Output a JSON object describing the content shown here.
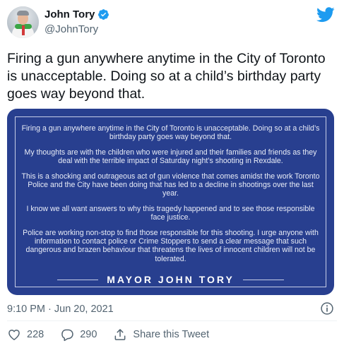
{
  "author": {
    "display_name": "John Tory",
    "handle": "@JohnTory",
    "verified": true
  },
  "tweet": {
    "text": "Firing a gun anywhere anytime in the City of Toronto is unacceptable. Doing so at a child’s birthday party goes way beyond that.",
    "timestamp": "9:10 PM · Jun 20, 2021"
  },
  "media": {
    "paragraphs": [
      "Firing a gun anywhere anytime in the City of Toronto is unacceptable. Doing so at a child’s birthday party goes way beyond that.",
      "My thoughts are with the children who were injured and their families and friends as they deal with the terrible impact of Saturday night’s shooting in Rexdale.",
      "This is a shocking and outrageous act of gun violence that comes amidst the work Toronto Police and the City have been doing that has led to a decline in shootings over the last year.",
      "I know we all want answers to why this tragedy happened and to see those responsible face justice.",
      "Police are working non-stop to find those responsible for this shooting. I urge anyone with information to contact police or Crime Stoppers to send a clear message that such dangerous and brazen behaviour that threatens the lives of innocent children will not be tolerated."
    ],
    "signature": "MAYOR JOHN TORY",
    "background_color": "#283f8f"
  },
  "actions": {
    "likes": "228",
    "replies": "290",
    "share_label": "Share this Tweet"
  },
  "colors": {
    "twitter_blue": "#1d9bf0",
    "muted_text": "#536471"
  }
}
